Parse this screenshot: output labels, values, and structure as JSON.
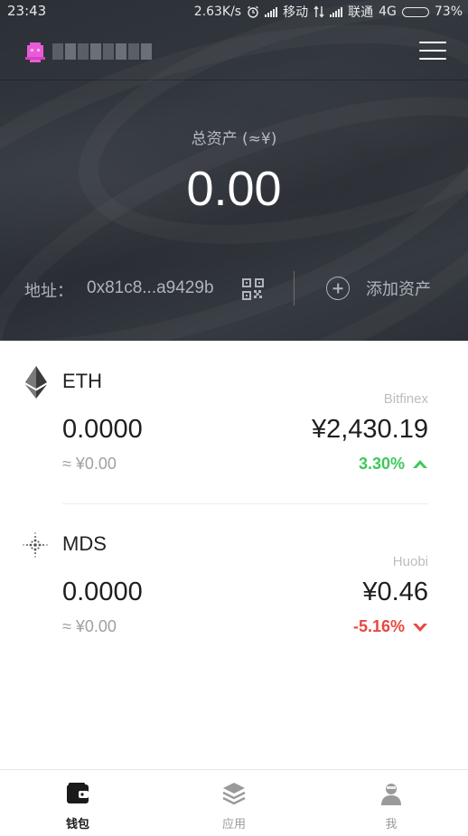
{
  "status_bar": {
    "time": "23:43",
    "speed": "2.63K/s",
    "carrier1": "移动",
    "carrier2": "联通",
    "network": "4G",
    "battery_text": "73%",
    "battery_level": 0.73
  },
  "header": {
    "logo_icon": "robot-avatar-icon",
    "menu_icon": "hamburger-menu-icon"
  },
  "summary": {
    "total_label": "总资产 (≈¥)",
    "total_value": "0.00",
    "address_label": "地址：",
    "address_value": "0x81c8...a9429b",
    "qr_icon": "qr-code-icon",
    "add_asset_label": "添加资产"
  },
  "assets": [
    {
      "symbol": "ETH",
      "icon": "ethereum-icon",
      "exchange": "Bitfinex",
      "balance": "0.0000",
      "fiat": "≈ ¥0.00",
      "price": "¥2,430.19",
      "change": "3.30%",
      "direction": "up",
      "color": "#3ec85a"
    },
    {
      "symbol": "MDS",
      "icon": "mds-dots-icon",
      "exchange": "Huobi",
      "balance": "0.0000",
      "fiat": "≈ ¥0.00",
      "price": "¥0.46",
      "change": "-5.16%",
      "direction": "down",
      "color": "#e8483f"
    }
  ],
  "bottom_nav": {
    "items": [
      {
        "label": "钱包",
        "icon": "wallet-icon",
        "active": true
      },
      {
        "label": "应用",
        "icon": "layers-icon",
        "active": false
      },
      {
        "label": "我",
        "icon": "user-icon",
        "active": false
      }
    ],
    "active_color": "#1a1a1a",
    "inactive_color": "#9a9a9a"
  }
}
